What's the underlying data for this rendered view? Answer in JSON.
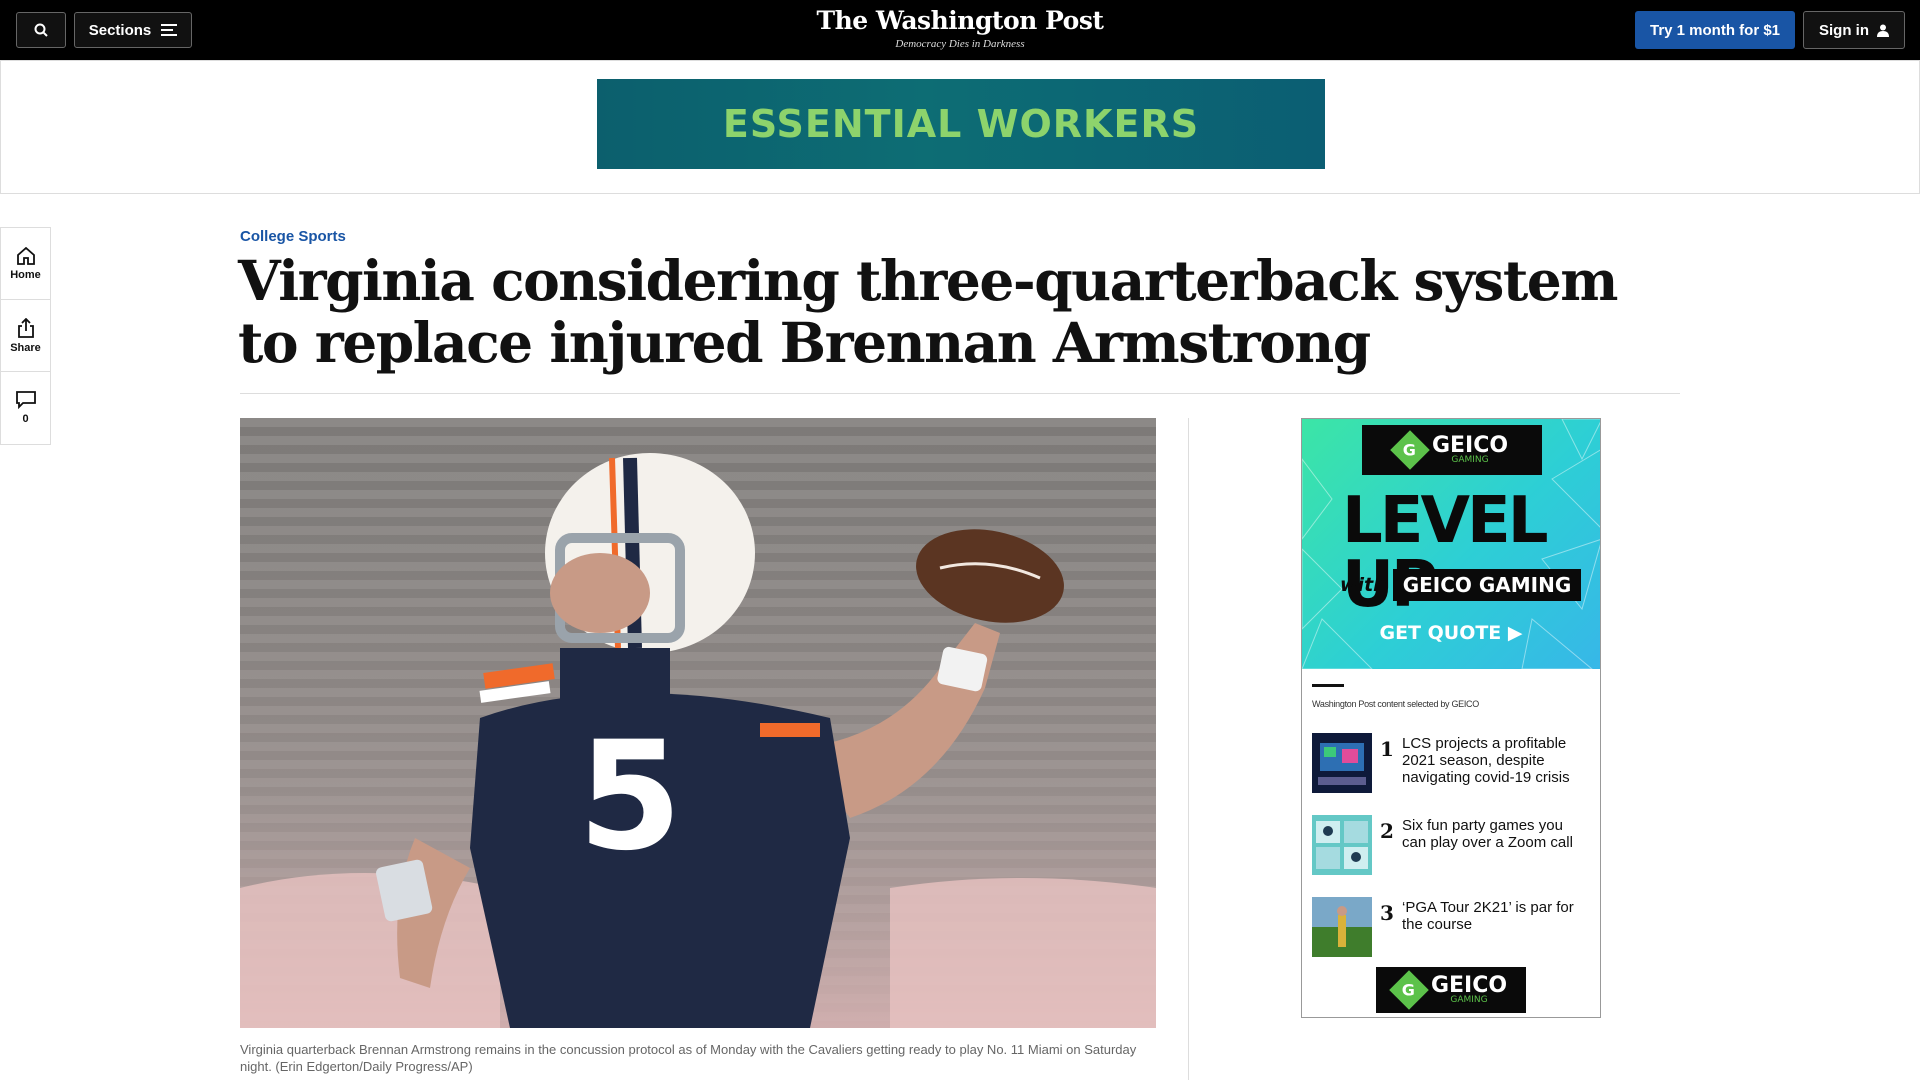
{
  "header": {
    "sections_label": "Sections",
    "logo": "The Washington Post",
    "tagline": "Democracy Dies in Darkness",
    "subscribe_label": "Try 1 month for $1",
    "signin_label": "Sign in"
  },
  "banner_ad": {
    "text": "ESSENTIAL WORKERS"
  },
  "rail": {
    "home_label": "Home",
    "share_label": "Share",
    "comments_count": "0"
  },
  "article": {
    "kicker": "College Sports",
    "headline": "Virginia considering three-quarterback system to replace injured Brennan Armstrong",
    "photo": {
      "jersey_number": "5"
    },
    "caption": "Virginia quarterback Brennan Armstrong remains in the concussion protocol as of Monday with the Cavaliers getting ready to play No. 11 Miami on Saturday night. (Erin Edgerton/Daily Progress/AP)"
  },
  "sidebar_ad": {
    "brand": "GEICO",
    "brand_sub": "GAMING",
    "headline": "LEVEL UP",
    "with_text": "with",
    "product": "GEICO GAMING",
    "cta": "GET QUOTE ▶",
    "selected_label": "Washington Post content selected by GEICO",
    "stories": [
      {
        "num": "1",
        "title": "LCS projects a profitable 2021 season, despite navigating covid-19 crisis"
      },
      {
        "num": "2",
        "title": "Six fun party games you can play over a Zoom call"
      },
      {
        "num": "3",
        "title": "‘PGA Tour 2K21’ is par for the course"
      }
    ]
  },
  "colors": {
    "accent_blue": "#1955a5",
    "banner_green": "#8dd36c",
    "geico_green": "#5cc24a"
  }
}
